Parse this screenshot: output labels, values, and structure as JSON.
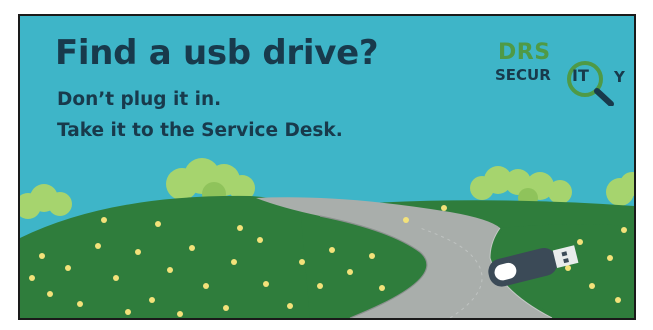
{
  "poster": {
    "headline": "Find a usb drive?",
    "line1": "Don’t plug it in.",
    "line2": "Take it to the Service Desk."
  },
  "logo": {
    "top": "DRS",
    "left": "SECUR",
    "circled": "IT",
    "right": "Y"
  },
  "colors": {
    "sky": "#3eb5c8",
    "grass": "#2f7d3c",
    "road": "#a9aeab",
    "text": "#183a4c",
    "logo_green": "#4f9a46"
  }
}
